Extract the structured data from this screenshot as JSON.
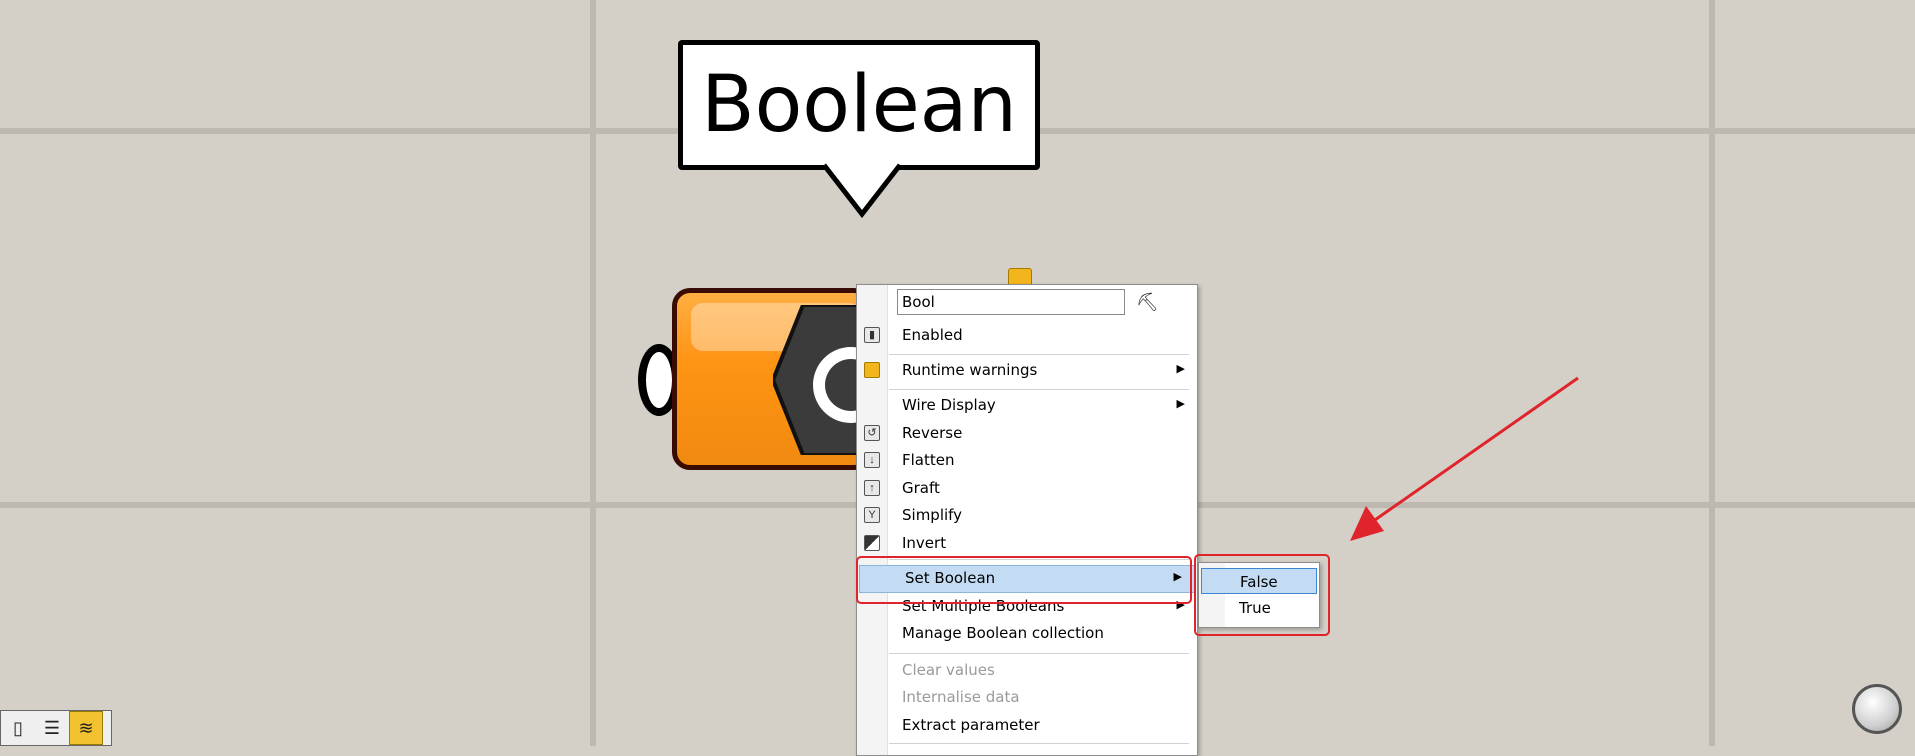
{
  "canvas": {
    "background": "#d4d0c8"
  },
  "tooltip": {
    "text": "Boolean"
  },
  "context_menu": {
    "name_field_value": "Bool",
    "items": [
      {
        "label": "Enabled",
        "icon": "enabled-icon",
        "submenu": false,
        "disabled": false
      },
      {
        "label": "Runtime warnings",
        "icon": "warning-icon",
        "submenu": true,
        "disabled": false
      },
      {
        "label": "Wire Display",
        "icon": "",
        "submenu": true,
        "disabled": false
      },
      {
        "label": "Reverse",
        "icon": "reverse-icon",
        "submenu": false,
        "disabled": false
      },
      {
        "label": "Flatten",
        "icon": "flatten-icon",
        "submenu": false,
        "disabled": false
      },
      {
        "label": "Graft",
        "icon": "graft-icon",
        "submenu": false,
        "disabled": false
      },
      {
        "label": "Simplify",
        "icon": "simplify-icon",
        "submenu": false,
        "disabled": false
      },
      {
        "label": "Invert",
        "icon": "invert-icon",
        "submenu": false,
        "disabled": false
      },
      {
        "label": "Set Boolean",
        "icon": "",
        "submenu": true,
        "disabled": false,
        "highlighted": true
      },
      {
        "label": "Set Multiple Booleans",
        "icon": "",
        "submenu": true,
        "disabled": false
      },
      {
        "label": "Manage Boolean collection",
        "icon": "",
        "submenu": false,
        "disabled": false
      },
      {
        "label": "Clear values",
        "icon": "",
        "submenu": false,
        "disabled": true
      },
      {
        "label": "Internalise data",
        "icon": "",
        "submenu": false,
        "disabled": true
      },
      {
        "label": "Extract parameter",
        "icon": "",
        "submenu": false,
        "disabled": false
      }
    ]
  },
  "submenu": {
    "items": [
      {
        "label": "False",
        "highlighted": true
      },
      {
        "label": "True",
        "highlighted": false
      }
    ]
  },
  "annotation": {
    "color": "#e0242b"
  },
  "toolbar": {
    "buttons": [
      "phone-icon",
      "list-icon",
      "wave-icon"
    ],
    "active_color": "#f2c230"
  }
}
